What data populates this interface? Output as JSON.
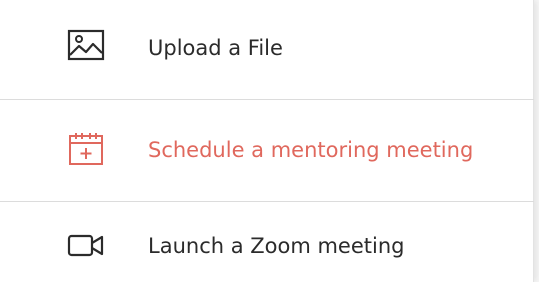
{
  "menu": {
    "items": [
      {
        "label": "Upload a File",
        "icon": "image-icon",
        "active": false
      },
      {
        "label": "Schedule a mentoring meeting",
        "icon": "calendar-add-icon",
        "active": true
      },
      {
        "label": "Launch a Zoom meeting",
        "icon": "video-camera-icon",
        "active": false
      }
    ]
  },
  "colors": {
    "active_accent": "#e0685d",
    "text": "#2b2b2b",
    "icon": "#2b2b2b",
    "divider": "#dcdcdc",
    "background": "#ffffff"
  }
}
